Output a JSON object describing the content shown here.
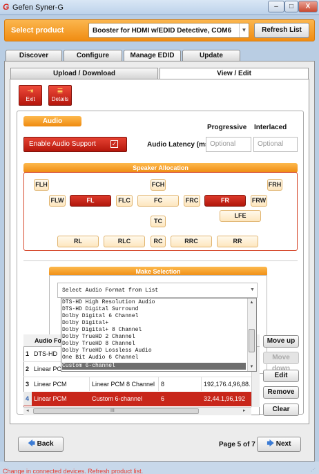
{
  "window": {
    "title": "Gefen Syner-G",
    "logo": "G",
    "minimize": "–",
    "maximize": "□",
    "close": "X"
  },
  "product": {
    "label": "Select product",
    "value": "Booster for HDMI w/EDID Detective, COM6",
    "refresh": "Refresh List"
  },
  "tabs": [
    "Discover",
    "Configure",
    "Manage EDID",
    "Update"
  ],
  "active_tab": "Manage EDID",
  "subtabs": [
    "Upload / Download",
    "View / Edit"
  ],
  "active_subtab": "View / Edit",
  "actions": {
    "exit": "Exit",
    "details": "Details"
  },
  "audio": {
    "header": "Audio",
    "enable_label": "Enable Audio Support",
    "enable_checked": true,
    "latency_label": "Audio Latency (ms)",
    "progressive_label": "Progressive",
    "interlaced_label": "Interlaced",
    "progressive_placeholder": "Optional",
    "interlaced_placeholder": "Optional"
  },
  "speaker": {
    "header": "Speaker Allocation",
    "buttons": [
      {
        "label": "FLH",
        "on": false
      },
      {
        "label": "FCH",
        "on": false
      },
      {
        "label": "FRH",
        "on": false
      },
      {
        "label": "FLW",
        "on": false
      },
      {
        "label": "FL",
        "on": true
      },
      {
        "label": "FLC",
        "on": false
      },
      {
        "label": "FC",
        "on": false
      },
      {
        "label": "FRC",
        "on": false
      },
      {
        "label": "FR",
        "on": true
      },
      {
        "label": "FRW",
        "on": false
      },
      {
        "label": "LFE",
        "on": false
      },
      {
        "label": "TC",
        "on": false
      },
      {
        "label": "RL",
        "on": false
      },
      {
        "label": "RLC",
        "on": false
      },
      {
        "label": "RC",
        "on": false
      },
      {
        "label": "RRC",
        "on": false
      },
      {
        "label": "RR",
        "on": false
      }
    ]
  },
  "selection": {
    "header": "Make Selection",
    "combo_text": "Select Audio Format from List",
    "options": [
      "DTS-HD High Resolution Audio",
      "DTS-HD Digital Surround",
      "Dolby Digital 6 Channel",
      "Dolby Digital+",
      "Dolby Digital+ 8 Channel",
      "Dolby TrueHD 2 Channel",
      "Dolby TrueHD 8 Channel",
      "Dolby TrueHD Lossless Audio",
      "One Bit Audio 6 Channel",
      "Custom 6-channel"
    ],
    "selected": "Custom 6-channel"
  },
  "table": {
    "header_col1": "Audio Fo",
    "rows": [
      {
        "num": "1",
        "col1": "DTS-HD",
        "col2": "",
        "col3": "",
        "col4": ""
      },
      {
        "num": "2",
        "col1": "Linear PC",
        "col2": "",
        "col3": "",
        "col4": ""
      },
      {
        "num": "3",
        "col1": "Linear PCM",
        "col2": "Linear PCM 8 Channel",
        "col3": "8",
        "col4": "192,176.4,96,88."
      },
      {
        "num": "4",
        "col1": "Linear PCM",
        "col2": "Custom 6-channel",
        "col3": "6",
        "col4": "32,44.1,96,192"
      }
    ],
    "selected_row": 4,
    "hscroll_mid": "III"
  },
  "side_buttons": [
    "Move up",
    "Move down",
    "Edit",
    "Remove",
    "Clear"
  ],
  "nav": {
    "back": "Back",
    "page": "Page 5 of 7",
    "next": "Next"
  },
  "status": "Change in connected devices. Refresh product list."
}
